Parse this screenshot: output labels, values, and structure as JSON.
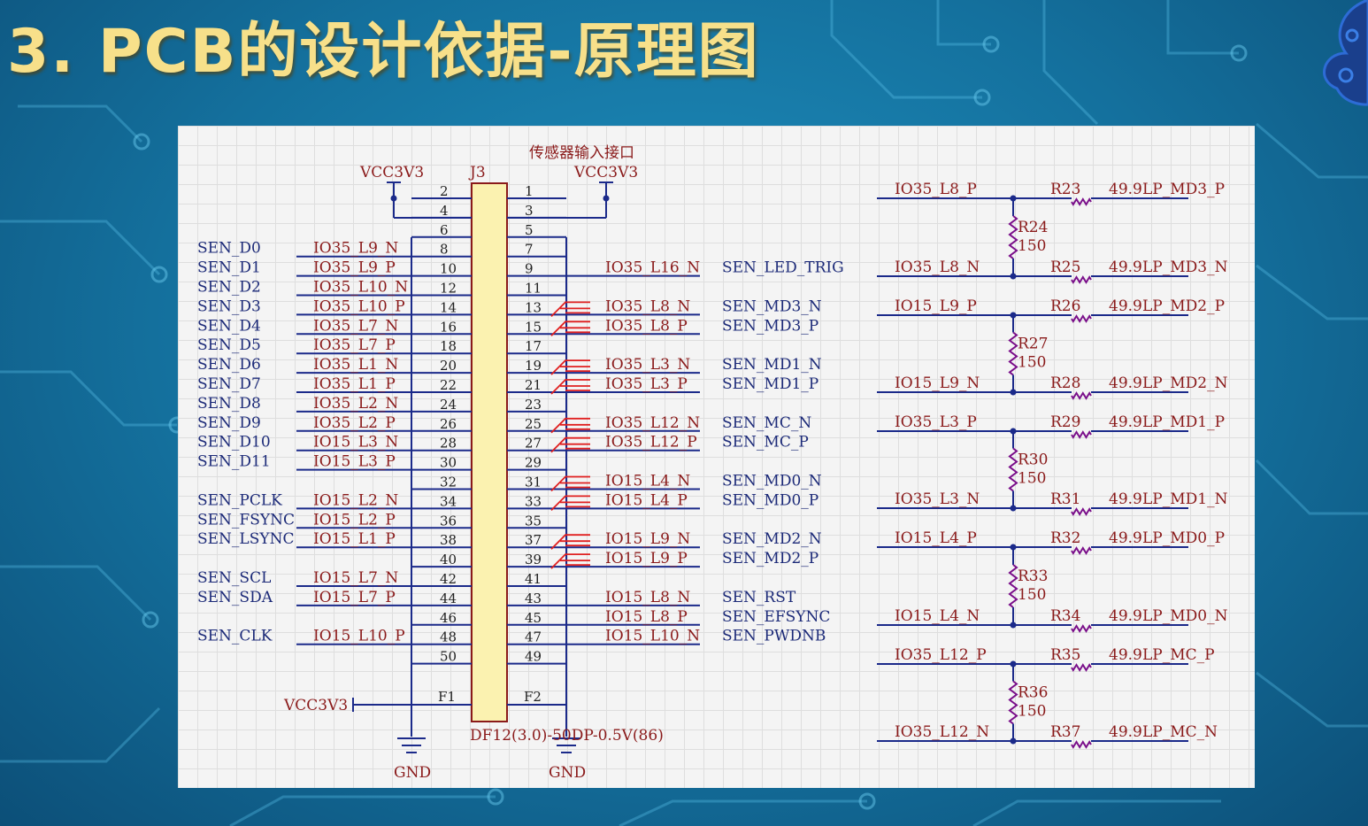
{
  "title": "3. PCB的设计依据-原理图",
  "schematic": {
    "caption": "传感器输入接口",
    "designator": "J3",
    "part_number": "DF12(3.0)-50DP-0.5V(86)",
    "vcc_left": "VCC3V3",
    "vcc_right": "VCC3V3",
    "vcc_f1": "VCC3V3",
    "gnd_left": "GND",
    "gnd_right": "GND",
    "f1": "F1",
    "f2": "F2",
    "left_pins": [
      {
        "num": "2",
        "sig": "",
        "net": ""
      },
      {
        "num": "4",
        "sig": "",
        "net": ""
      },
      {
        "num": "6",
        "sig": "",
        "net": ""
      },
      {
        "num": "8",
        "sig": "SEN_D0",
        "net": "IO35_L9_N"
      },
      {
        "num": "10",
        "sig": "SEN_D1",
        "net": "IO35_L9_P"
      },
      {
        "num": "12",
        "sig": "SEN_D2",
        "net": "IO35_L10_N"
      },
      {
        "num": "14",
        "sig": "SEN_D3",
        "net": "IO35_L10_P"
      },
      {
        "num": "16",
        "sig": "SEN_D4",
        "net": "IO35_L7_N"
      },
      {
        "num": "18",
        "sig": "SEN_D5",
        "net": "IO35_L7_P"
      },
      {
        "num": "20",
        "sig": "SEN_D6",
        "net": "IO35_L1_N"
      },
      {
        "num": "22",
        "sig": "SEN_D7",
        "net": "IO35_L1_P"
      },
      {
        "num": "24",
        "sig": "SEN_D8",
        "net": "IO35_L2_N"
      },
      {
        "num": "26",
        "sig": "SEN_D9",
        "net": "IO35_L2_P"
      },
      {
        "num": "28",
        "sig": "SEN_D10",
        "net": "IO15_L3_N"
      },
      {
        "num": "30",
        "sig": "SEN_D11",
        "net": "IO15_L3_P"
      },
      {
        "num": "32",
        "sig": "",
        "net": ""
      },
      {
        "num": "34",
        "sig": "SEN_PCLK",
        "net": "IO15_L2_N"
      },
      {
        "num": "36",
        "sig": "SEN_FSYNC",
        "net": "IO15_L2_P"
      },
      {
        "num": "38",
        "sig": "SEN_LSYNC",
        "net": "IO15_L1_P"
      },
      {
        "num": "40",
        "sig": "",
        "net": ""
      },
      {
        "num": "42",
        "sig": "SEN_SCL",
        "net": "IO15_L7_N"
      },
      {
        "num": "44",
        "sig": "SEN_SDA",
        "net": "IO15_L7_P"
      },
      {
        "num": "46",
        "sig": "",
        "net": ""
      },
      {
        "num": "48",
        "sig": "SEN_CLK",
        "net": "IO15_L10_P"
      },
      {
        "num": "50",
        "sig": "",
        "net": ""
      }
    ],
    "right_pins": [
      {
        "num": "1",
        "net": "",
        "sig": "",
        "diff": false
      },
      {
        "num": "3",
        "net": "",
        "sig": "",
        "diff": false
      },
      {
        "num": "5",
        "net": "",
        "sig": "",
        "diff": false
      },
      {
        "num": "7",
        "net": "",
        "sig": "",
        "diff": false
      },
      {
        "num": "9",
        "net": "IO35_L16_N",
        "sig": "SEN_LED_TRIG",
        "diff": false
      },
      {
        "num": "11",
        "net": "",
        "sig": "",
        "diff": false
      },
      {
        "num": "13",
        "net": "IO35_L8_N",
        "sig": "SEN_MD3_N",
        "diff": true
      },
      {
        "num": "15",
        "net": "IO35_L8_P",
        "sig": "SEN_MD3_P",
        "diff": true
      },
      {
        "num": "17",
        "net": "",
        "sig": "",
        "diff": false
      },
      {
        "num": "19",
        "net": "IO35_L3_N",
        "sig": "SEN_MD1_N",
        "diff": true
      },
      {
        "num": "21",
        "net": "IO35_L3_P",
        "sig": "SEN_MD1_P",
        "diff": true
      },
      {
        "num": "23",
        "net": "",
        "sig": "",
        "diff": false
      },
      {
        "num": "25",
        "net": "IO35_L12_N",
        "sig": "SEN_MC_N",
        "diff": true
      },
      {
        "num": "27",
        "net": "IO35_L12_P",
        "sig": "SEN_MC_P",
        "diff": true
      },
      {
        "num": "29",
        "net": "",
        "sig": "",
        "diff": false
      },
      {
        "num": "31",
        "net": "IO15_L4_N",
        "sig": "SEN_MD0_N",
        "diff": true
      },
      {
        "num": "33",
        "net": "IO15_L4_P",
        "sig": "SEN_MD0_P",
        "diff": true
      },
      {
        "num": "35",
        "net": "",
        "sig": "",
        "diff": false
      },
      {
        "num": "37",
        "net": "IO15_L9_N",
        "sig": "SEN_MD2_N",
        "diff": true
      },
      {
        "num": "39",
        "net": "IO15_L9_P",
        "sig": "SEN_MD2_P",
        "diff": true
      },
      {
        "num": "41",
        "net": "",
        "sig": "",
        "diff": false
      },
      {
        "num": "43",
        "net": "IO15_L8_N",
        "sig": "SEN_RST",
        "diff": false
      },
      {
        "num": "45",
        "net": "IO15_L8_P",
        "sig": "SEN_EFSYNC",
        "diff": false
      },
      {
        "num": "47",
        "net": "IO15_L10_N",
        "sig": "SEN_PWDNB",
        "diff": false
      },
      {
        "num": "49",
        "net": "",
        "sig": "",
        "diff": false
      }
    ],
    "terminations": [
      {
        "p_in": "IO35_L8_P",
        "p_res": "R23",
        "p_val": "49.9",
        "p_out": "LP_MD3_P",
        "shunt": "R24",
        "shunt_val": "150",
        "n_in": "IO35_L8_N",
        "n_res": "R25",
        "n_val": "49.9",
        "n_out": "LP_MD3_N"
      },
      {
        "p_in": "IO15_L9_P",
        "p_res": "R26",
        "p_val": "49.9",
        "p_out": "LP_MD2_P",
        "shunt": "R27",
        "shunt_val": "150",
        "n_in": "IO15_L9_N",
        "n_res": "R28",
        "n_val": "49.9",
        "n_out": "LP_MD2_N"
      },
      {
        "p_in": "IO35_L3_P",
        "p_res": "R29",
        "p_val": "49.9",
        "p_out": "LP_MD1_P",
        "shunt": "R30",
        "shunt_val": "150",
        "n_in": "IO35_L3_N",
        "n_res": "R31",
        "n_val": "49.9",
        "n_out": "LP_MD1_N"
      },
      {
        "p_in": "IO15_L4_P",
        "p_res": "R32",
        "p_val": "49.9",
        "p_out": "LP_MD0_P",
        "shunt": "R33",
        "shunt_val": "150",
        "n_in": "IO15_L4_N",
        "n_res": "R34",
        "n_val": "49.9",
        "n_out": "LP_MD0_N"
      },
      {
        "p_in": "IO35_L12_P",
        "p_res": "R35",
        "p_val": "49.9",
        "p_out": "LP_MC_P",
        "shunt": "R36",
        "shunt_val": "150",
        "n_in": "IO35_L12_N",
        "n_res": "R37",
        "n_val": "49.9",
        "n_out": "LP_MC_N"
      }
    ]
  }
}
